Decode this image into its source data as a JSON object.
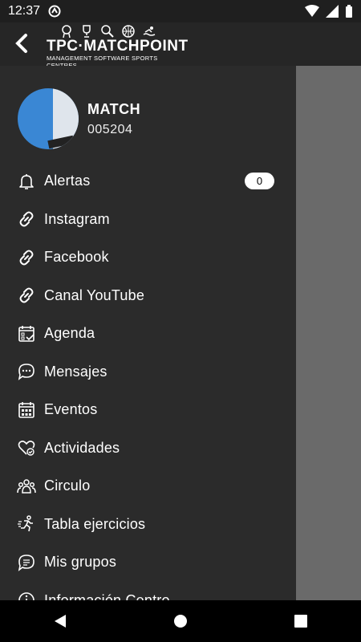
{
  "status": {
    "time": "12:37"
  },
  "brand": {
    "name": "TPC·MATCHPOINT",
    "tagline": "MANAGEMENT SOFTWARE SPORTS CENTRES"
  },
  "user": {
    "name": "MATCH",
    "code": "005204"
  },
  "menu": {
    "items": [
      {
        "label": "Alertas",
        "icon": "bell-icon",
        "badge": "0"
      },
      {
        "label": "Instagram",
        "icon": "link-icon"
      },
      {
        "label": "Facebook",
        "icon": "link-icon"
      },
      {
        "label": "Canal YouTube",
        "icon": "link-icon"
      },
      {
        "label": "Agenda",
        "icon": "calendar-check-icon"
      },
      {
        "label": "Mensajes",
        "icon": "chat-bubble-icon"
      },
      {
        "label": "Eventos",
        "icon": "calendar-grid-icon"
      },
      {
        "label": "Actividades",
        "icon": "heart-check-icon"
      },
      {
        "label": "Circulo",
        "icon": "group-icon"
      },
      {
        "label": "Tabla ejercicios",
        "icon": "running-icon"
      },
      {
        "label": "Mis grupos",
        "icon": "chat-lines-icon"
      },
      {
        "label": "Información Centro",
        "icon": "info-icon"
      }
    ]
  }
}
